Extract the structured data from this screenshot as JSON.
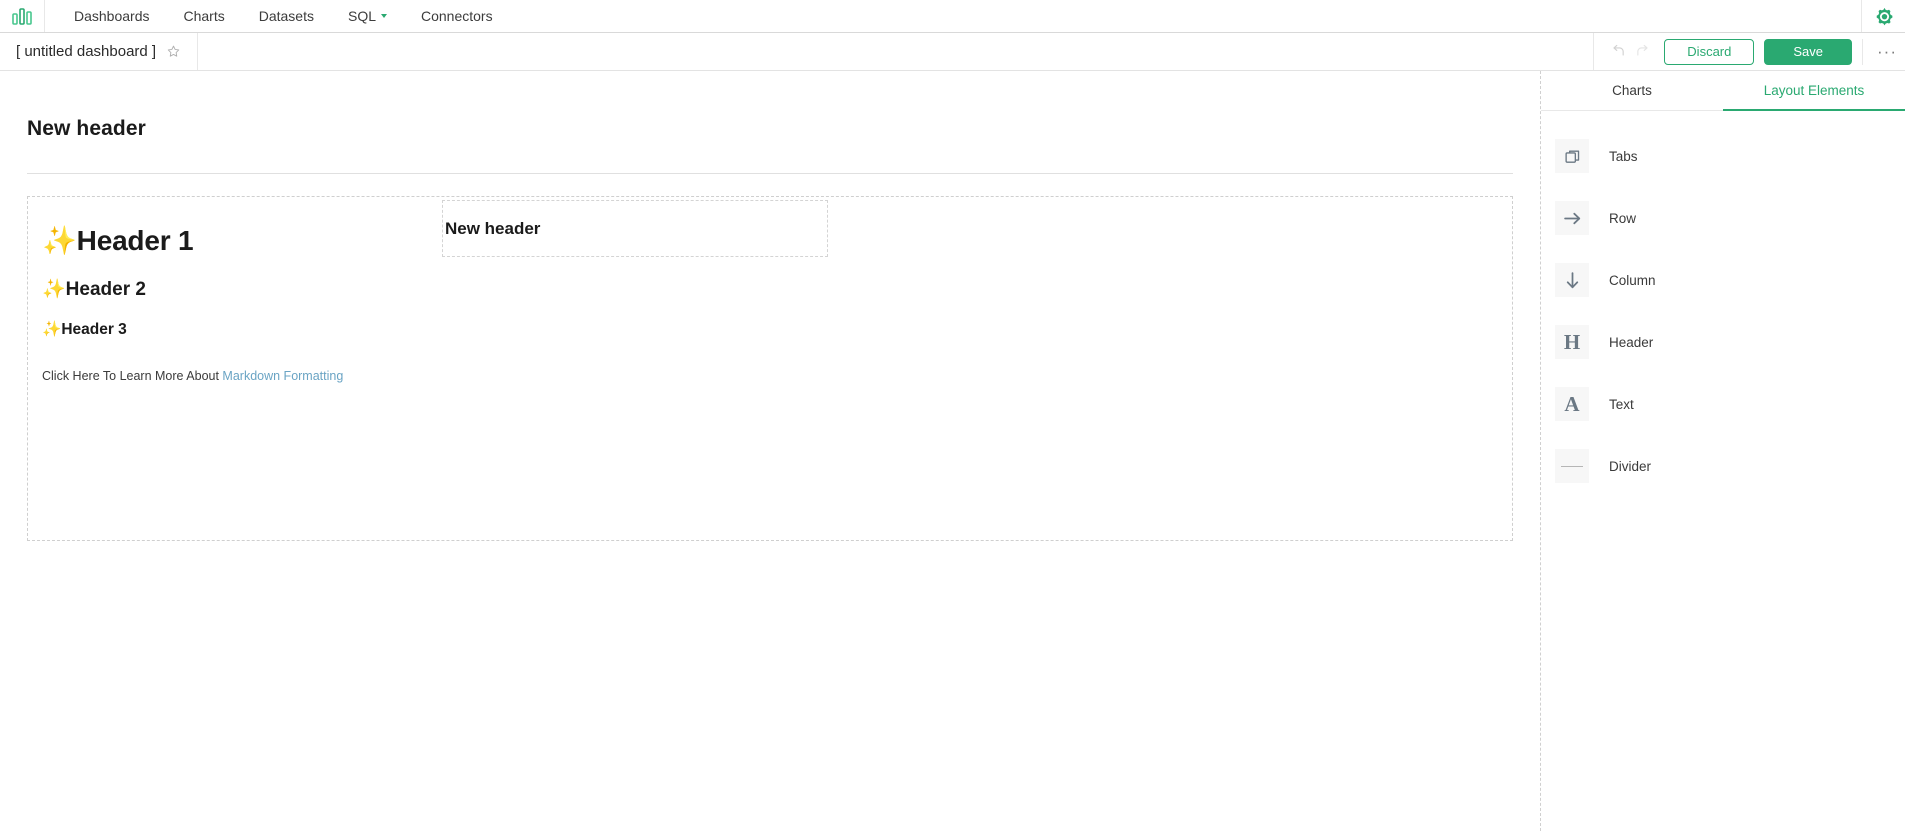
{
  "navbar": {
    "logo_icon": "bar-chart-logo",
    "links": [
      {
        "label": "Dashboards",
        "has_caret": false
      },
      {
        "label": "Charts",
        "has_caret": false
      },
      {
        "label": "Datasets",
        "has_caret": false
      },
      {
        "label": "SQL",
        "has_caret": true
      },
      {
        "label": "Connectors",
        "has_caret": false
      }
    ],
    "settings_icon": "gear-icon",
    "accent_color": "#2aa971"
  },
  "edit_header": {
    "dashboard_title": "[ untitled dashboard ]",
    "favorite_icon": "star-icon",
    "undo_icon": "undo-arrow-icon",
    "redo_icon": "redo-arrow-icon",
    "discard_label": "Discard",
    "save_label": "Save",
    "more_label": "···"
  },
  "canvas": {
    "top_header_text": "New header",
    "markdown": {
      "sparkle": "✨",
      "h1": "Header 1",
      "h2": "Header 2",
      "h3": "Header 3",
      "paragraph_prefix": "Click Here To Learn More About ",
      "link_text": "Markdown Formatting",
      "link_color": "#6aa4c4"
    },
    "inner_header_text": "New header"
  },
  "side_panel": {
    "tabs": [
      {
        "label": "Charts",
        "active": false
      },
      {
        "label": "Layout Elements",
        "active": true
      }
    ],
    "elements": [
      {
        "label": "Tabs",
        "icon": "tabs-icon"
      },
      {
        "label": "Row",
        "icon": "arrow-right-icon"
      },
      {
        "label": "Column",
        "icon": "arrow-down-icon"
      },
      {
        "label": "Header",
        "icon": "header-h-icon",
        "glyph": "H"
      },
      {
        "label": "Text",
        "icon": "text-a-icon",
        "glyph": "A"
      },
      {
        "label": "Divider",
        "icon": "divider-line-icon"
      }
    ]
  }
}
